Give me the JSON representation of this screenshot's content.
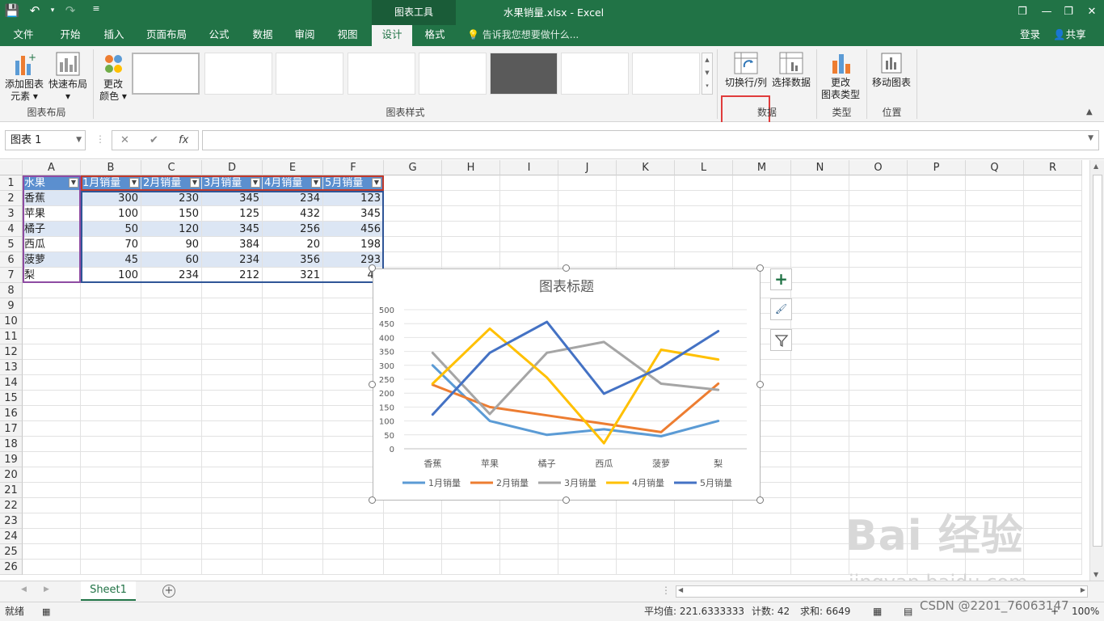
{
  "titlebar": {
    "context_tab": "图表工具",
    "doc_title": "水果销量.xlsx - Excel"
  },
  "tabs": [
    "文件",
    "开始",
    "插入",
    "页面布局",
    "公式",
    "数据",
    "审阅",
    "视图",
    "设计",
    "格式"
  ],
  "tellme": "告诉我您想要做什么...",
  "account": {
    "login": "登录",
    "share": "共享"
  },
  "ribbon": {
    "add_element_1": "添加图表",
    "add_element_2": "元素",
    "quick_layout": "快速布局",
    "change_color_1": "更改",
    "change_color_2": "颜色",
    "group_layout": "图表布局",
    "group_styles": "图表样式",
    "switch_row_col": "切换行/列",
    "select_data": "选择数据",
    "group_data": "数据",
    "change_type_1": "更改",
    "change_type_2": "图表类型",
    "group_type": "类型",
    "move_chart": "移动图表",
    "group_location": "位置"
  },
  "formula_bar": {
    "name_box": "图表 1",
    "fx": "fx"
  },
  "columns": [
    "A",
    "B",
    "C",
    "D",
    "E",
    "F",
    "G",
    "H",
    "I",
    "J",
    "K",
    "L",
    "M",
    "N",
    "O",
    "P",
    "Q",
    "R"
  ],
  "rows": [
    "1",
    "2",
    "3",
    "4",
    "5",
    "6",
    "7",
    "8",
    "9",
    "10",
    "11",
    "12",
    "13",
    "14",
    "15",
    "16",
    "17",
    "18",
    "19",
    "20",
    "21",
    "22",
    "23",
    "24",
    "25",
    "26"
  ],
  "table": {
    "headers": [
      "水果",
      "1月销量",
      "2月销量",
      "3月销量",
      "4月销量",
      "5月销量"
    ],
    "rows": [
      [
        "香蕉",
        "300",
        "230",
        "345",
        "234",
        "123"
      ],
      [
        "苹果",
        "100",
        "150",
        "125",
        "432",
        "345"
      ],
      [
        "橘子",
        "50",
        "120",
        "345",
        "256",
        "456"
      ],
      [
        "西瓜",
        "70",
        "90",
        "384",
        "20",
        "198"
      ],
      [
        "菠萝",
        "45",
        "60",
        "234",
        "356",
        "293"
      ],
      [
        "梨",
        "100",
        "234",
        "212",
        "321",
        "42"
      ]
    ]
  },
  "sheet": {
    "tab": "Sheet1"
  },
  "status": {
    "ready": "就绪",
    "average": "平均值: 221.6333333",
    "count": "计数: 42",
    "sum": "求和: 6649",
    "zoom": "100%"
  },
  "watermark": {
    "text": "Bai 经验",
    "url": "jingyan.baidu.com",
    "csdn": "CSDN @2201_76063147"
  },
  "colors": {
    "accent": "#217346",
    "s1": "#5b9bd5",
    "s2": "#ed7d31",
    "s3": "#a5a5a5",
    "s4": "#ffc000",
    "s5": "#4472c4"
  },
  "chart_data": {
    "type": "line",
    "title": "图表标题",
    "categories": [
      "香蕉",
      "苹果",
      "橘子",
      "西瓜",
      "菠萝",
      "梨"
    ],
    "yticks": [
      "500",
      "450",
      "400",
      "350",
      "300",
      "250",
      "200",
      "150",
      "100",
      "50",
      "0"
    ],
    "ylim": [
      0,
      500
    ],
    "grid": true,
    "legend_position": "bottom",
    "series": [
      {
        "name": "1月销量",
        "values": [
          300,
          100,
          50,
          70,
          45,
          100
        ],
        "color": "#5b9bd5"
      },
      {
        "name": "2月销量",
        "values": [
          230,
          150,
          120,
          90,
          60,
          234
        ],
        "color": "#ed7d31"
      },
      {
        "name": "3月销量",
        "values": [
          345,
          125,
          345,
          384,
          234,
          212
        ],
        "color": "#a5a5a5"
      },
      {
        "name": "4月销量",
        "values": [
          234,
          432,
          256,
          20,
          356,
          321
        ],
        "color": "#ffc000"
      },
      {
        "name": "5月销量",
        "values": [
          123,
          345,
          456,
          198,
          293,
          423
        ],
        "color": "#4472c4"
      }
    ]
  }
}
